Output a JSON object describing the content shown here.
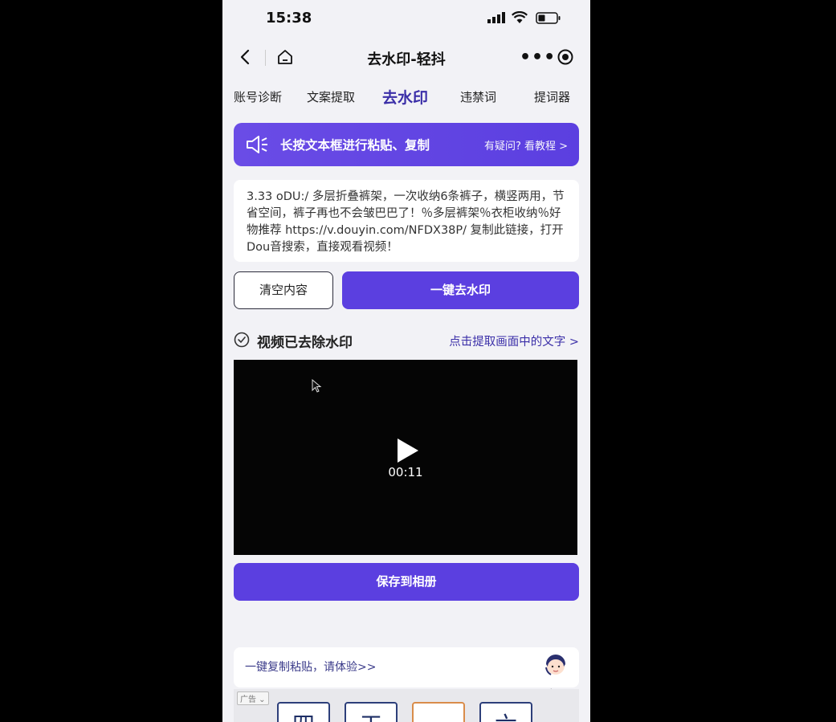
{
  "status_bar": {
    "time": "15:38"
  },
  "nav": {
    "title": "去水印-轻抖",
    "more": "•••"
  },
  "tabs": [
    {
      "label": "账号诊断"
    },
    {
      "label": "文案提取"
    },
    {
      "label": "去水印"
    },
    {
      "label": "违禁词"
    },
    {
      "label": "提词器"
    }
  ],
  "banner": {
    "text": "长按文本框进行粘贴、复制",
    "link": "有疑问? 看教程 >"
  },
  "textbox": {
    "value": "3.33 oDU:/ 多层折叠裤架，一次收纳6条裤子，横竖两用，节省空间，裤子再也不会皱巴巴了！％多层裤架％衣柜收纳％好物推荐 https://v.douyin.com/NFDX38P/ 复制此链接，打开Dou音搜索，直接观看视频！"
  },
  "buttons": {
    "clear": "清空内容",
    "remove": "一键去水印",
    "save": "保存到相册"
  },
  "result": {
    "label": "视频已去除水印",
    "extract_link": "点击提取画面中的文字 >"
  },
  "video": {
    "duration": "00:11"
  },
  "bottom": {
    "promo": "一键复制粘贴，请体验>>",
    "service_label": "客服",
    "ad_tag": "广告 ⌄"
  },
  "ad_cards": [
    {
      "char": "四"
    },
    {
      "char": "工"
    },
    {
      "char": ""
    },
    {
      "char": "六"
    }
  ],
  "colors": {
    "accent": "#5b3fe0",
    "tab_active": "#3b2fa8"
  }
}
